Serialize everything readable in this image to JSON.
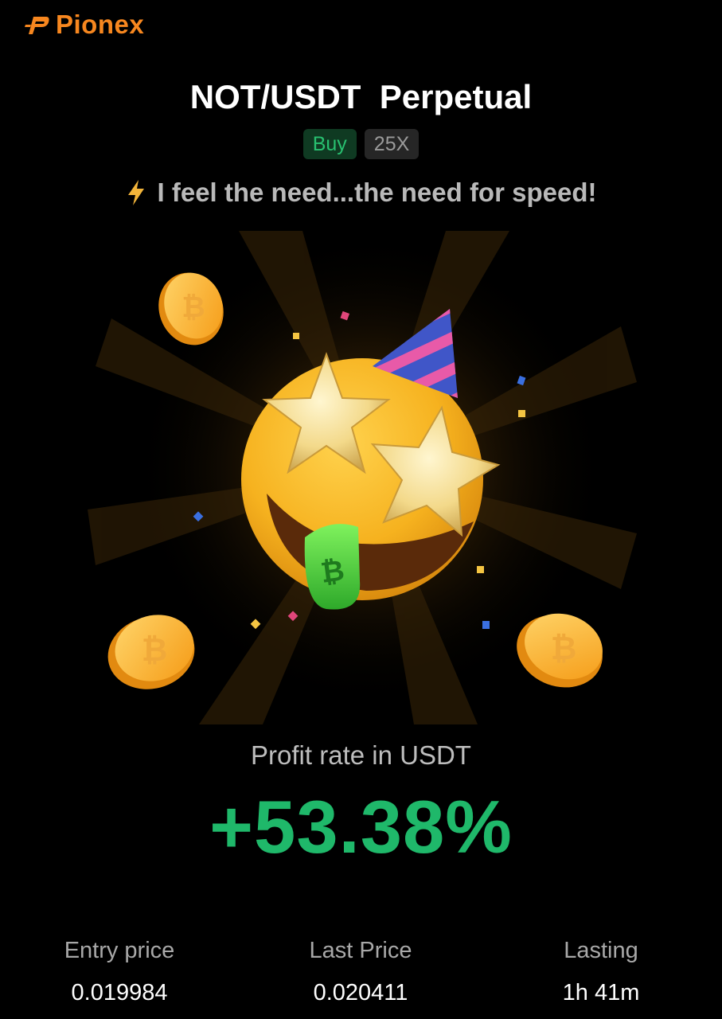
{
  "brand": {
    "name": "Pionex",
    "icon": "pionex-logo-icon",
    "color": "#f7871f"
  },
  "header": {
    "pair": "NOT/USDT",
    "contract": "Perpetual",
    "side": "Buy",
    "leverage": "25X",
    "slogan_icon": "lightning-bolt-icon",
    "slogan": "I feel the need...the need for speed!"
  },
  "illustration": {
    "emoji": "star-struck-party-emoji",
    "coin_icon": "bitcoin-coin-icon"
  },
  "profit": {
    "label": "Profit rate in USDT",
    "value": "+53.38%",
    "color": "#1fb86a"
  },
  "stats": [
    {
      "label": "Entry price",
      "value": "0.019984"
    },
    {
      "label": "Last Price",
      "value": "0.020411"
    },
    {
      "label": "Lasting",
      "value": "1h 41m"
    }
  ]
}
